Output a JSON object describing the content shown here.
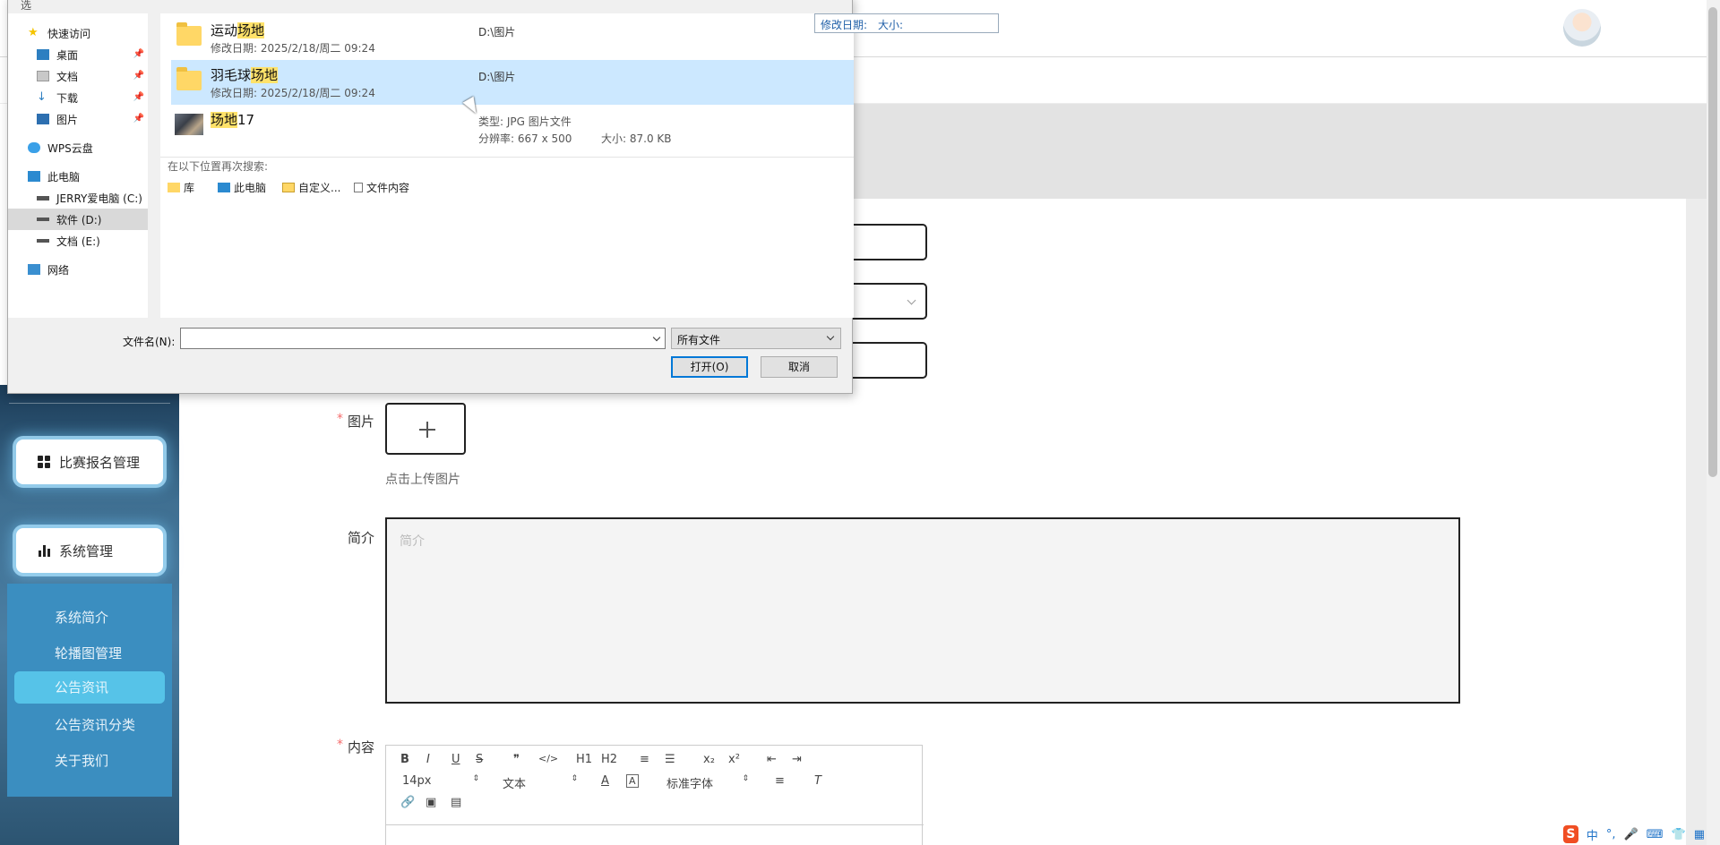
{
  "dialog": {
    "title": "选",
    "column_headers": {
      "date": "修改日期:",
      "size": "大小:"
    },
    "nav": [
      {
        "label": "快速访问",
        "icon": "star-icon"
      },
      {
        "label": "桌面",
        "icon": "desktop-icon"
      },
      {
        "label": "文档",
        "icon": "document-icon"
      },
      {
        "label": "下载",
        "icon": "download-icon"
      },
      {
        "label": "图片",
        "icon": "pictures-icon"
      },
      {
        "label": "WPS云盘",
        "icon": "cloud-icon"
      },
      {
        "label": "此电脑",
        "icon": "computer-icon"
      },
      {
        "label": "JERRY爱电脑 (C:)",
        "icon": "drive-icon"
      },
      {
        "label": "软件 (D:)",
        "icon": "drive-icon",
        "selected": true
      },
      {
        "label": "文档 (E:)",
        "icon": "drive-icon"
      },
      {
        "label": "网络",
        "icon": "network-icon"
      }
    ],
    "results": [
      {
        "name_pre": "运动",
        "name_hl": "场地",
        "name_post": "",
        "date": "修改日期: 2025/2/18/周二 09:24",
        "path": "D:\\图片",
        "icon": "folder-icon"
      },
      {
        "name_pre": "羽毛球",
        "name_hl": "场地",
        "name_post": "",
        "date": "修改日期: 2025/2/18/周二 09:24",
        "path": "D:\\图片",
        "icon": "folder-icon",
        "selected": true
      },
      {
        "name_pre": "",
        "name_hl": "场地",
        "name_post": "17",
        "type": "类型: JPG 图片文件",
        "resolution": "分辨率: 667 x 500",
        "size": "大小: 87.0 KB",
        "icon": "image-thumbnail-icon"
      }
    ],
    "search_again": "在以下位置再次搜索:",
    "search_locations": [
      "库",
      "此电脑",
      "自定义...",
      "文件内容"
    ],
    "filename_label": "文件名(N):",
    "filename_value": "",
    "filetype": "所有文件",
    "open_button": "打开(O)",
    "cancel_button": "取消"
  },
  "sidebar": {
    "menu": [
      {
        "label": "比赛报名管理",
        "icon": "grid-icon"
      },
      {
        "label": "系统管理",
        "icon": "bar-chart-icon"
      }
    ],
    "submenu": [
      {
        "label": "系统简介"
      },
      {
        "label": "轮播图管理"
      },
      {
        "label": "公告资讯",
        "active": true
      },
      {
        "label": "公告资讯分类"
      },
      {
        "label": "关于我们"
      }
    ]
  },
  "form": {
    "image_label": "图片",
    "upload_tip": "点击上传图片",
    "intro_label": "简介",
    "intro_placeholder": "简介",
    "content_label": "内容",
    "required_mark": "*",
    "editor": {
      "font_size": "14px",
      "header": "文本",
      "font_family": "标准字体",
      "tools": [
        "B",
        "I",
        "U",
        "S",
        "❞",
        "</>",
        "H1",
        "H2",
        "≡",
        "☰",
        "x₂",
        "x²",
        "⇤",
        "⇥"
      ]
    }
  },
  "ime": {
    "logo": "S",
    "mode": "中"
  },
  "colors": {
    "accent": "#0078d7",
    "highlight": "#ffe26a",
    "active_submenu": "#56c3e8",
    "required": "#f56c6c"
  }
}
